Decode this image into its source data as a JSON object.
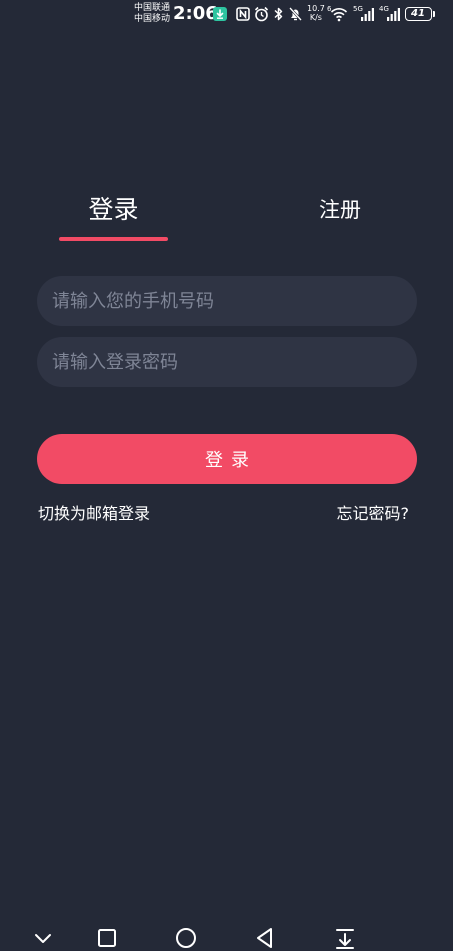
{
  "status_bar": {
    "carrier_1": "中国联通",
    "carrier_2": "中国移动",
    "time": "2:06",
    "net_speed_value": "10.7",
    "net_speed_unit": "K/s",
    "wifi_badge": "6",
    "sim1_network": "5G",
    "sim2_network": "4G",
    "battery_level": "41",
    "icons": [
      "download-app-icon",
      "nfc-icon",
      "alarm-icon",
      "bluetooth-icon",
      "mute-icon",
      "wifi-icon",
      "signal-icon",
      "battery-icon"
    ]
  },
  "tabs": {
    "login": "登录",
    "register": "注册"
  },
  "form": {
    "phone_placeholder": "请输入您的手机号码",
    "password_placeholder": "请输入登录密码",
    "login_button": "登录"
  },
  "links": {
    "switch_email": "切换为邮箱登录",
    "forgot_password": "忘记密码?"
  },
  "nav_bar": {
    "icons": [
      "chevron-down-icon",
      "square-icon",
      "circle-icon",
      "triangle-back-icon",
      "pull-down-icon"
    ]
  },
  "colors": {
    "background": "#242937",
    "input_background": "#2f3444",
    "accent": "#f24b65",
    "placeholder": "#7f8596"
  }
}
